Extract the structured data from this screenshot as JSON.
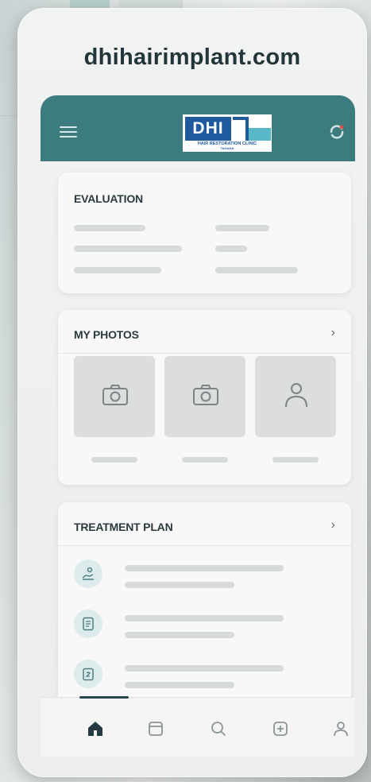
{
  "site": {
    "url": "dhihairimplant.com"
  },
  "header": {
    "logo_text": "DHI",
    "logo_tagline": "HAIR RESTORATION CLINIC",
    "logo_location": "TAGANA",
    "menu_icon": "hamburger-menu-icon",
    "action_icon": "refresh-icon"
  },
  "evaluation": {
    "title": "EVALUATION"
  },
  "photos": {
    "title": "MY PHOTOS",
    "chevron": "›",
    "tiles": [
      {
        "icon": "camera-icon"
      },
      {
        "icon": "camera-icon"
      },
      {
        "icon": "person-icon"
      }
    ]
  },
  "treatment": {
    "title": "TREATMENT PLAN",
    "chevron": "›",
    "items": [
      {
        "icon": "hand-care-icon"
      },
      {
        "icon": "document-icon"
      },
      {
        "icon": "clipboard-icon"
      }
    ]
  },
  "bottom_nav": {
    "items": [
      {
        "icon": "home-icon",
        "active": true
      },
      {
        "icon": "folder-icon",
        "active": false
      },
      {
        "icon": "search-icon",
        "active": false
      },
      {
        "icon": "medical-icon",
        "active": false
      },
      {
        "icon": "profile-icon",
        "active": false
      }
    ]
  },
  "colors": {
    "brand_teal": "#3c7b7e",
    "logo_blue": "#1f5a9e",
    "logo_cyan": "#57b9c7",
    "text_dark": "#2b3a3e"
  }
}
